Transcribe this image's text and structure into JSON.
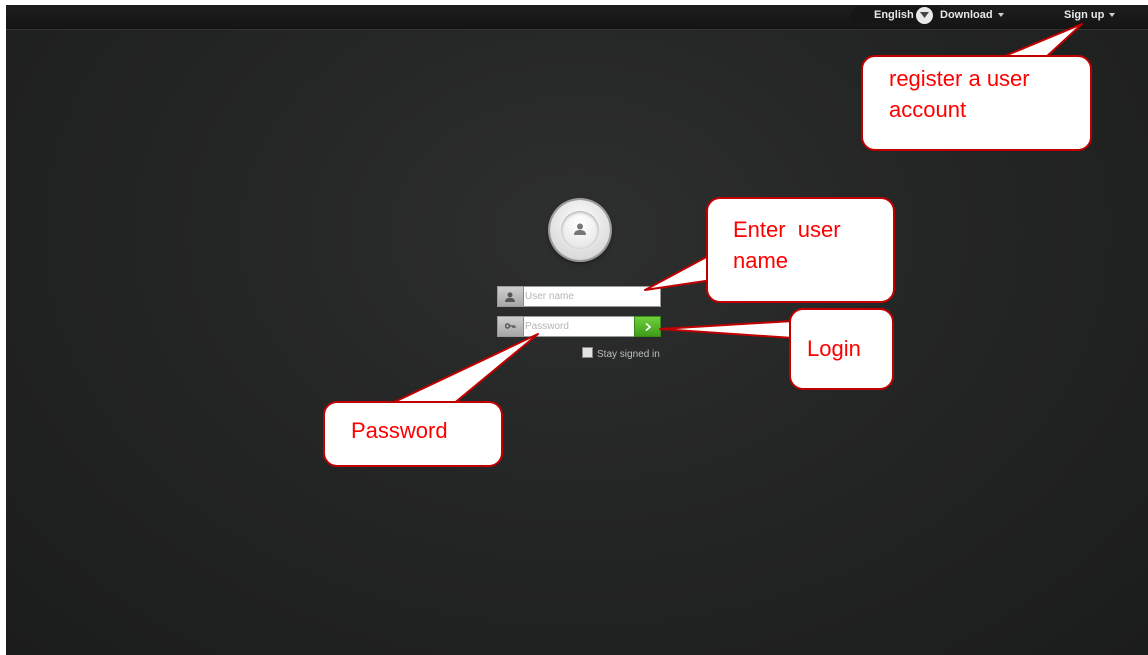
{
  "topbar": {
    "language": "English",
    "language_dropdown_icon": "chevron-down-icon",
    "download_label": "Download",
    "signup_label": "Sign up"
  },
  "login": {
    "avatar_icon": "user-icon",
    "username_placeholder": "User name",
    "password_placeholder": "Password",
    "login_button_icon": "chevron-right-icon",
    "stay_signed_in_label": "Stay signed in",
    "stay_signed_in_checked": false
  },
  "annotations": {
    "register_line1": "register a user",
    "register_line2": "account",
    "username_line1": "Enter  user",
    "username_line2": "name",
    "login": "Login",
    "password": "Password"
  },
  "colors": {
    "background": "#232424",
    "login_button": "#4caf2a",
    "annotation_text": "#ff0000",
    "annotation_border": "#c00000"
  }
}
